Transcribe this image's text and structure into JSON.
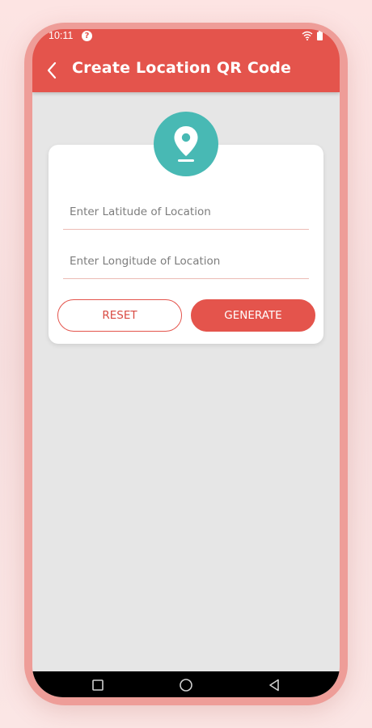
{
  "status_bar": {
    "time": "10:11",
    "alert_symbol": "?",
    "icons": [
      "alert-icon",
      "wifi-icon",
      "battery-icon"
    ]
  },
  "header": {
    "back_icon": "chevron-left-icon",
    "title": "Create Location QR Code"
  },
  "form": {
    "badge_icon": "location-pin-icon",
    "latitude": {
      "placeholder": "Enter Latitude of Location",
      "value": ""
    },
    "longitude": {
      "placeholder": "Enter Longitude of Location",
      "value": ""
    },
    "reset_label": "RESET",
    "generate_label": "GENERATE"
  },
  "nav": {
    "icons": [
      "recents-square-icon",
      "home-circle-icon",
      "back-triangle-icon"
    ]
  },
  "colors": {
    "primary": "#e4544c",
    "accent_teal": "#48b9b4",
    "screen_background": "#e6e6e6",
    "card_background": "#ffffff",
    "frame": "#ee9d98",
    "nav_bar": "#000000"
  }
}
